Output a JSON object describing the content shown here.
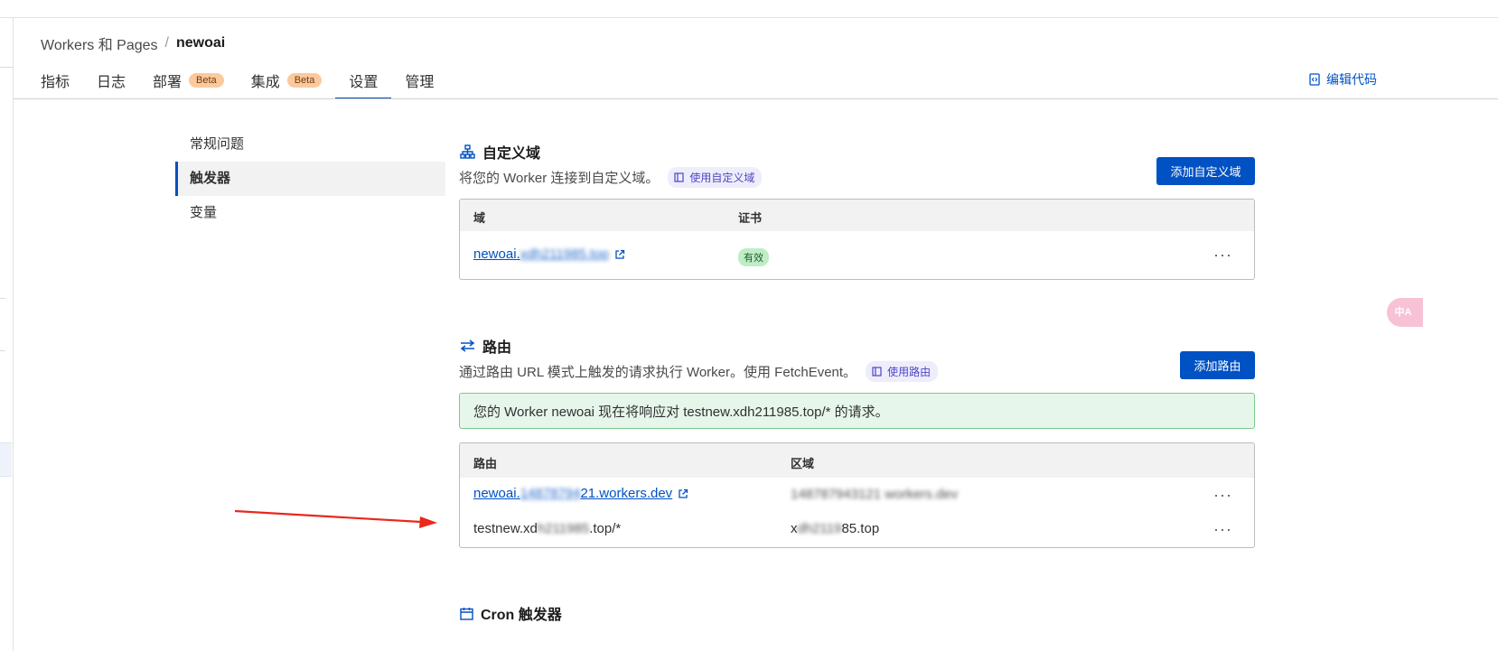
{
  "breadcrumb": {
    "root": "Workers 和 Pages",
    "separator": "/",
    "current": "newoai"
  },
  "tabs": [
    {
      "label": "指标"
    },
    {
      "label": "日志"
    },
    {
      "label": "部署",
      "badge": "Beta"
    },
    {
      "label": "集成",
      "badge": "Beta"
    },
    {
      "label": "设置",
      "active": true
    },
    {
      "label": "管理"
    }
  ],
  "edit_code": {
    "label": "编辑代码",
    "icon": "code-icon"
  },
  "sidenav": {
    "items": [
      {
        "label": "常规问题"
      },
      {
        "label": "触发器",
        "active": true
      },
      {
        "label": "变量"
      }
    ]
  },
  "custom_domain": {
    "title": "自定义域",
    "icon": "sitemap-icon",
    "description": "将您的 Worker 连接到自定义域。",
    "doc_link": "使用自定义域",
    "add_button": "添加自定义域",
    "table": {
      "headers": [
        "域",
        "证书"
      ],
      "rows": [
        {
          "domain_visible": "newoai.",
          "domain_redacted": "xdh211985.top",
          "certificate": "有效"
        }
      ]
    }
  },
  "routes": {
    "title": "路由",
    "icon": "swap-arrows-icon",
    "description": "通过路由 URL 模式上触发的请求执行 Worker。使用 FetchEvent。",
    "doc_link": "使用路由",
    "add_button": "添加路由",
    "alert": "您的 Worker newoai 现在将响应对 testnew.xdh211985.top/* 的请求。",
    "table": {
      "headers": [
        "路由",
        "区域"
      ],
      "rows": [
        {
          "route_visible": "newoai.",
          "route_redacted": "14878794",
          "route_suffix": "21.workers.dev",
          "zone_redacted": "148787943121 workers.dev",
          "is_link": true
        },
        {
          "route_prefix": "testnew.xd",
          "route_redacted": "h211985",
          "route_suffix": ".top/*",
          "zone_prefix": "x",
          "zone_redacted": "dh2119",
          "zone_suffix": "85.top",
          "is_link": false
        }
      ]
    }
  },
  "cron": {
    "title": "Cron 触发器",
    "icon": "calendar-icon"
  },
  "translate_fab": {
    "label": "中A",
    "icon": "translate-icon"
  },
  "colors": {
    "accent": "#0051c3",
    "success_bg": "#e6f6ea",
    "success_border": "#7cc98b",
    "beta_badge": "#fcc99d",
    "annotation_arrow": "#e8291c"
  }
}
